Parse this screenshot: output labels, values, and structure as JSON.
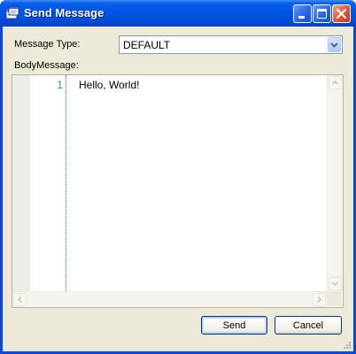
{
  "window": {
    "title": "Send Message",
    "icon": "app-window-icon",
    "controls": [
      "minimize-icon",
      "maximize-icon",
      "close-icon"
    ]
  },
  "form": {
    "message_type_label": "Message Type:",
    "message_type_value": "DEFAULT",
    "body_label": "BodyMessage:"
  },
  "editor": {
    "lines": [
      {
        "number": "1",
        "text": "Hello, World!"
      }
    ]
  },
  "buttons": {
    "send": "Send",
    "cancel": "Cancel"
  },
  "colors": {
    "titlebar": "#0055e5",
    "frame": "#0a48d8",
    "dialog_bg": "#ece9d8",
    "line_number": "#2f8a9f"
  }
}
